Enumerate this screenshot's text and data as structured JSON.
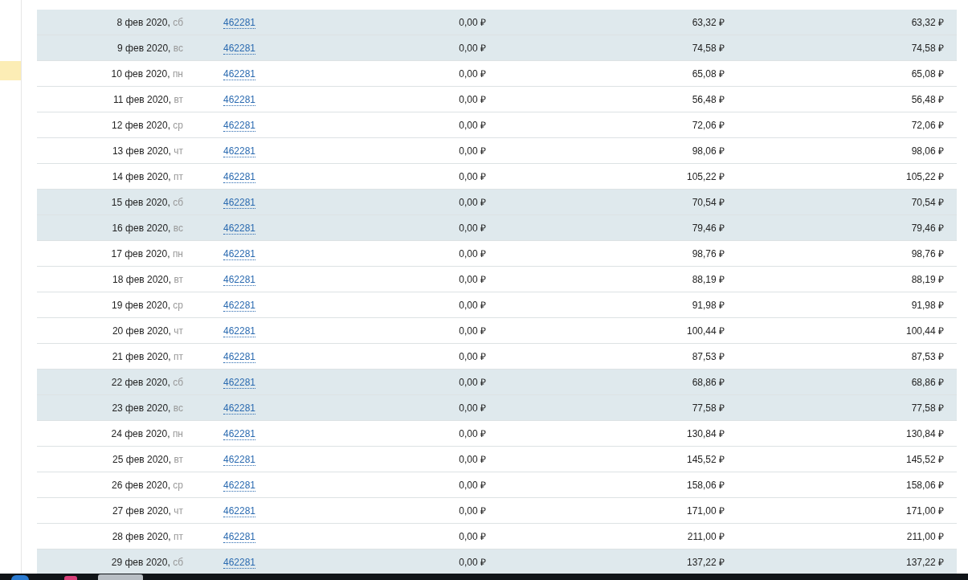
{
  "rows": [
    {
      "date": "8 фев 2020,",
      "weekday": "сб",
      "weekend": true,
      "id": "462281",
      "column_3": "0,00 ₽",
      "column_4": "63,32 ₽",
      "column_5": "63,32 ₽"
    },
    {
      "date": "9 фев 2020,",
      "weekday": "вс",
      "weekend": true,
      "id": "462281",
      "column_3": "0,00 ₽",
      "column_4": "74,58 ₽",
      "column_5": "74,58 ₽"
    },
    {
      "date": "10 фев 2020,",
      "weekday": "пн",
      "weekend": false,
      "id": "462281",
      "column_3": "0,00 ₽",
      "column_4": "65,08 ₽",
      "column_5": "65,08 ₽"
    },
    {
      "date": "11 фев 2020,",
      "weekday": "вт",
      "weekend": false,
      "id": "462281",
      "column_3": "0,00 ₽",
      "column_4": "56,48 ₽",
      "column_5": "56,48 ₽"
    },
    {
      "date": "12 фев 2020,",
      "weekday": "ср",
      "weekend": false,
      "id": "462281",
      "column_3": "0,00 ₽",
      "column_4": "72,06 ₽",
      "column_5": "72,06 ₽"
    },
    {
      "date": "13 фев 2020,",
      "weekday": "чт",
      "weekend": false,
      "id": "462281",
      "column_3": "0,00 ₽",
      "column_4": "98,06 ₽",
      "column_5": "98,06 ₽"
    },
    {
      "date": "14 фев 2020,",
      "weekday": "пт",
      "weekend": false,
      "id": "462281",
      "column_3": "0,00 ₽",
      "column_4": "105,22 ₽",
      "column_5": "105,22 ₽"
    },
    {
      "date": "15 фев 2020,",
      "weekday": "сб",
      "weekend": true,
      "id": "462281",
      "column_3": "0,00 ₽",
      "column_4": "70,54 ₽",
      "column_5": "70,54 ₽"
    },
    {
      "date": "16 фев 2020,",
      "weekday": "вс",
      "weekend": true,
      "id": "462281",
      "column_3": "0,00 ₽",
      "column_4": "79,46 ₽",
      "column_5": "79,46 ₽"
    },
    {
      "date": "17 фев 2020,",
      "weekday": "пн",
      "weekend": false,
      "id": "462281",
      "column_3": "0,00 ₽",
      "column_4": "98,76 ₽",
      "column_5": "98,76 ₽"
    },
    {
      "date": "18 фев 2020,",
      "weekday": "вт",
      "weekend": false,
      "id": "462281",
      "column_3": "0,00 ₽",
      "column_4": "88,19 ₽",
      "column_5": "88,19 ₽"
    },
    {
      "date": "19 фев 2020,",
      "weekday": "ср",
      "weekend": false,
      "id": "462281",
      "column_3": "0,00 ₽",
      "column_4": "91,98 ₽",
      "column_5": "91,98 ₽"
    },
    {
      "date": "20 фев 2020,",
      "weekday": "чт",
      "weekend": false,
      "id": "462281",
      "column_3": "0,00 ₽",
      "column_4": "100,44 ₽",
      "column_5": "100,44 ₽"
    },
    {
      "date": "21 фев 2020,",
      "weekday": "пт",
      "weekend": false,
      "id": "462281",
      "column_3": "0,00 ₽",
      "column_4": "87,53 ₽",
      "column_5": "87,53 ₽"
    },
    {
      "date": "22 фев 2020,",
      "weekday": "сб",
      "weekend": true,
      "id": "462281",
      "column_3": "0,00 ₽",
      "column_4": "68,86 ₽",
      "column_5": "68,86 ₽"
    },
    {
      "date": "23 фев 2020,",
      "weekday": "вс",
      "weekend": true,
      "id": "462281",
      "column_3": "0,00 ₽",
      "column_4": "77,58 ₽",
      "column_5": "77,58 ₽"
    },
    {
      "date": "24 фев 2020,",
      "weekday": "пн",
      "weekend": false,
      "id": "462281",
      "column_3": "0,00 ₽",
      "column_4": "130,84 ₽",
      "column_5": "130,84 ₽"
    },
    {
      "date": "25 фев 2020,",
      "weekday": "вт",
      "weekend": false,
      "id": "462281",
      "column_3": "0,00 ₽",
      "column_4": "145,52 ₽",
      "column_5": "145,52 ₽"
    },
    {
      "date": "26 фев 2020,",
      "weekday": "ср",
      "weekend": false,
      "id": "462281",
      "column_3": "0,00 ₽",
      "column_4": "158,06 ₽",
      "column_5": "158,06 ₽"
    },
    {
      "date": "27 фев 2020,",
      "weekday": "чт",
      "weekend": false,
      "id": "462281",
      "column_3": "0,00 ₽",
      "column_4": "171,00 ₽",
      "column_5": "171,00 ₽"
    },
    {
      "date": "28 фев 2020,",
      "weekday": "пт",
      "weekend": false,
      "id": "462281",
      "column_3": "0,00 ₽",
      "column_4": "211,00 ₽",
      "column_5": "211,00 ₽"
    },
    {
      "date": "29 фев 2020,",
      "weekday": "сб",
      "weekend": true,
      "id": "462281",
      "column_3": "0,00 ₽",
      "column_4": "137,22 ₽",
      "column_5": "137,22 ₽"
    }
  ]
}
